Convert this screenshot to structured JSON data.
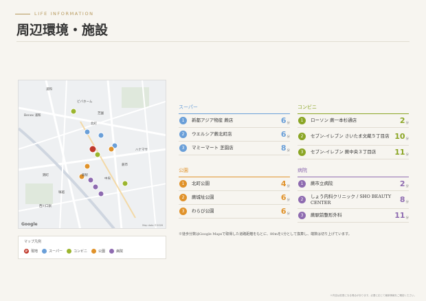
{
  "header": {
    "kicker": "LIFE INFORMATION",
    "title": "周辺環境・施設"
  },
  "map": {
    "credit": "Map data ©2026",
    "google": "Google",
    "labels": [
      "浦和",
      "Benex 浦和",
      "ビバホーム",
      "芝園",
      "蕨市",
      "蕨駅",
      "中央",
      "錦町",
      "塚越",
      "北町",
      "ハナマサ",
      "西川口駅"
    ]
  },
  "legend": {
    "title": "マップ凡例",
    "items": [
      {
        "label": "現地",
        "color": "#c0392b",
        "mark": "P"
      },
      {
        "label": "スーパー",
        "color": "#6a9fd8",
        "mark": ""
      },
      {
        "label": "コンビニ",
        "color": "#9bb52e",
        "mark": ""
      },
      {
        "label": "公園",
        "color": "#e0922a",
        "mark": ""
      },
      {
        "label": "病院",
        "color": "#8e6bb0",
        "mark": ""
      }
    ]
  },
  "sections": {
    "super": {
      "heading": "スーパー",
      "color": "#6a9fd8",
      "items": [
        {
          "no": "1",
          "name": "新都アジア物産 蕨店",
          "min": "6",
          "unit": "分"
        },
        {
          "no": "2",
          "name": "ウエルシア蕨北町店",
          "min": "6",
          "unit": "分"
        },
        {
          "no": "3",
          "name": "マミーマート 芝園店",
          "min": "8",
          "unit": "分"
        }
      ]
    },
    "conveni": {
      "heading": "コンビニ",
      "color": "#8aa524",
      "items": [
        {
          "no": "1",
          "name": "ローソン 蕨一本杉通店",
          "min": "2",
          "unit": "分"
        },
        {
          "no": "2",
          "name": "セブン-イレブン さいたま文蔵５丁目店",
          "min": "10",
          "unit": "分"
        },
        {
          "no": "3",
          "name": "セブン-イレブン 蕨中央３丁目店",
          "min": "11",
          "unit": "分"
        }
      ]
    },
    "park": {
      "heading": "公園",
      "color": "#e0922a",
      "items": [
        {
          "no": "1",
          "name": "北町公園",
          "min": "4",
          "unit": "分"
        },
        {
          "no": "2",
          "name": "蕨城址公園",
          "min": "6",
          "unit": "分"
        },
        {
          "no": "3",
          "name": "わらび公園",
          "min": "6",
          "unit": "分"
        }
      ]
    },
    "hospital": {
      "heading": "病院",
      "color": "#8e6bb0",
      "items": [
        {
          "no": "1",
          "name": "蕨市立病院",
          "min": "2",
          "unit": "分"
        },
        {
          "no": "2",
          "name": "しょう内科クリニック / SHO BEAUTY CENTER",
          "min": "8",
          "unit": "分"
        },
        {
          "no": "3",
          "name": "蕨駅前整形外科",
          "min": "11",
          "unit": "分"
        }
      ]
    }
  },
  "note": "※徒歩分数はGoogle Mapsで取得した道路距離をもとに、80mを1分として換算し、端数は切り上げています。",
  "footnote": "※内容は変更になる場合があります。必要に応じて最新情報をご確認ください。"
}
